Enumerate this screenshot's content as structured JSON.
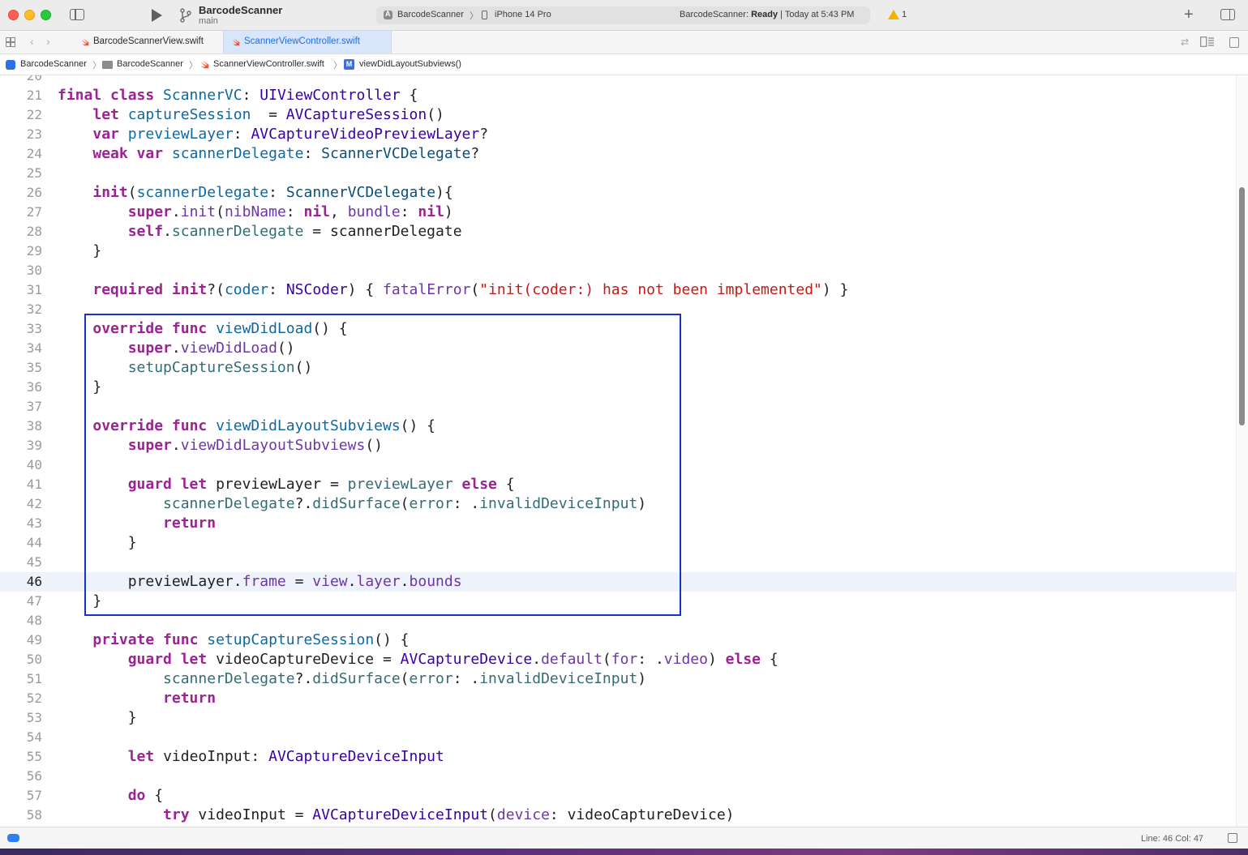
{
  "window": {
    "project_name": "BarcodeScanner",
    "branch": "main",
    "scheme": "BarcodeScanner",
    "device": "iPhone 14 Pro",
    "status_prefix": "BarcodeScanner: ",
    "status_state": "Ready",
    "status_time": " | Today at 5:43 PM",
    "warning_count": "1"
  },
  "tabs": [
    {
      "label": "BarcodeScannerView.swift",
      "active": false
    },
    {
      "label": "ScannerViewController.swift",
      "active": true
    }
  ],
  "breadcrumb": [
    "BarcodeScanner",
    "BarcodeScanner",
    "ScannerViewController.swift",
    "viewDidLayoutSubviews()"
  ],
  "editor": {
    "current_line": 46,
    "lines": [
      {
        "n": "20",
        "t": [
          [
            "pl",
            ""
          ]
        ]
      },
      {
        "n": "21",
        "t": [
          [
            "kw",
            "final class "
          ],
          [
            "decl",
            "ScannerVC"
          ],
          [
            "pl",
            ": "
          ],
          [
            "tyd",
            "UIViewController"
          ],
          [
            "pl",
            " {"
          ]
        ]
      },
      {
        "n": "22",
        "t": [
          [
            "pl",
            "    "
          ],
          [
            "kw",
            "let "
          ],
          [
            "decl",
            "captureSession"
          ],
          [
            "pl",
            "  = "
          ],
          [
            "tyd",
            "AVCaptureSession"
          ],
          [
            "pl",
            "()"
          ]
        ]
      },
      {
        "n": "23",
        "t": [
          [
            "pl",
            "    "
          ],
          [
            "kw",
            "var "
          ],
          [
            "decl",
            "previewLayer"
          ],
          [
            "pl",
            ": "
          ],
          [
            "tyd",
            "AVCaptureVideoPreviewLayer"
          ],
          [
            "pl",
            "?"
          ]
        ]
      },
      {
        "n": "24",
        "t": [
          [
            "pl",
            "    "
          ],
          [
            "kw",
            "weak var "
          ],
          [
            "decl",
            "scannerDelegate"
          ],
          [
            "pl",
            ": "
          ],
          [
            "ty",
            "ScannerVCDelegate"
          ],
          [
            "pl",
            "?"
          ]
        ]
      },
      {
        "n": "25",
        "t": [
          [
            "pl",
            ""
          ]
        ]
      },
      {
        "n": "26",
        "t": [
          [
            "pl",
            "    "
          ],
          [
            "kw",
            "init"
          ],
          [
            "pl",
            "("
          ],
          [
            "decl",
            "scannerDelegate"
          ],
          [
            "pl",
            ": "
          ],
          [
            "ty",
            "ScannerVCDelegate"
          ],
          [
            "pl",
            "){"
          ]
        ]
      },
      {
        "n": "27",
        "t": [
          [
            "pl",
            "        "
          ],
          [
            "kw",
            "super"
          ],
          [
            "pl",
            "."
          ],
          [
            "fn",
            "init"
          ],
          [
            "pl",
            "("
          ],
          [
            "fn",
            "nibName"
          ],
          [
            "pl",
            ": "
          ],
          [
            "kw",
            "nil"
          ],
          [
            "pl",
            ", "
          ],
          [
            "fn",
            "bundle"
          ],
          [
            "pl",
            ": "
          ],
          [
            "kw",
            "nil"
          ],
          [
            "pl",
            ")"
          ]
        ]
      },
      {
        "n": "28",
        "t": [
          [
            "pl",
            "        "
          ],
          [
            "kw",
            "self"
          ],
          [
            "pl",
            "."
          ],
          [
            "mem",
            "scannerDelegate"
          ],
          [
            "pl",
            " = scannerDelegate"
          ]
        ]
      },
      {
        "n": "29",
        "t": [
          [
            "pl",
            "    }"
          ]
        ]
      },
      {
        "n": "30",
        "t": [
          [
            "pl",
            ""
          ]
        ]
      },
      {
        "n": "31",
        "t": [
          [
            "pl",
            "    "
          ],
          [
            "kw",
            "required init"
          ],
          [
            "pl",
            "?("
          ],
          [
            "decl",
            "coder"
          ],
          [
            "pl",
            ": "
          ],
          [
            "tyd",
            "NSCoder"
          ],
          [
            "pl",
            ") { "
          ],
          [
            "fn",
            "fatalError"
          ],
          [
            "pl",
            "("
          ],
          [
            "str",
            "\"init(coder:) has not been implemented\""
          ],
          [
            "pl",
            ") }"
          ]
        ]
      },
      {
        "n": "32",
        "t": [
          [
            "pl",
            ""
          ]
        ]
      },
      {
        "n": "33",
        "t": [
          [
            "pl",
            "    "
          ],
          [
            "kw",
            "override func "
          ],
          [
            "decl",
            "viewDidLoad"
          ],
          [
            "pl",
            "() {"
          ]
        ]
      },
      {
        "n": "34",
        "t": [
          [
            "pl",
            "        "
          ],
          [
            "kw",
            "super"
          ],
          [
            "pl",
            "."
          ],
          [
            "fn",
            "viewDidLoad"
          ],
          [
            "pl",
            "()"
          ]
        ]
      },
      {
        "n": "35",
        "t": [
          [
            "pl",
            "        "
          ],
          [
            "mem",
            "setupCaptureSession"
          ],
          [
            "pl",
            "()"
          ]
        ]
      },
      {
        "n": "36",
        "t": [
          [
            "pl",
            "    }"
          ]
        ]
      },
      {
        "n": "37",
        "t": [
          [
            "pl",
            ""
          ]
        ]
      },
      {
        "n": "38",
        "t": [
          [
            "pl",
            "    "
          ],
          [
            "kw",
            "override func "
          ],
          [
            "decl",
            "viewDidLayoutSubviews"
          ],
          [
            "pl",
            "() {"
          ]
        ]
      },
      {
        "n": "39",
        "t": [
          [
            "pl",
            "        "
          ],
          [
            "kw",
            "super"
          ],
          [
            "pl",
            "."
          ],
          [
            "fn",
            "viewDidLayoutSubviews"
          ],
          [
            "pl",
            "()"
          ]
        ]
      },
      {
        "n": "40",
        "t": [
          [
            "pl",
            ""
          ]
        ]
      },
      {
        "n": "41",
        "t": [
          [
            "pl",
            "        "
          ],
          [
            "kw",
            "guard let "
          ],
          [
            "pl",
            "previewLayer = "
          ],
          [
            "mem",
            "previewLayer"
          ],
          [
            "pl",
            " "
          ],
          [
            "kw",
            "else"
          ],
          [
            "pl",
            " {"
          ]
        ]
      },
      {
        "n": "42",
        "t": [
          [
            "pl",
            "            "
          ],
          [
            "mem",
            "scannerDelegate"
          ],
          [
            "pl",
            "?."
          ],
          [
            "mem",
            "didSurface"
          ],
          [
            "pl",
            "("
          ],
          [
            "mem",
            "error"
          ],
          [
            "pl",
            ": ."
          ],
          [
            "mem",
            "invalidDeviceInput"
          ],
          [
            "pl",
            ")"
          ]
        ]
      },
      {
        "n": "43",
        "t": [
          [
            "pl",
            "            "
          ],
          [
            "kw",
            "return"
          ]
        ]
      },
      {
        "n": "44",
        "t": [
          [
            "pl",
            "        }"
          ]
        ]
      },
      {
        "n": "45",
        "t": [
          [
            "pl",
            ""
          ]
        ]
      },
      {
        "n": "46",
        "t": [
          [
            "pl",
            "        previewLayer."
          ],
          [
            "fn",
            "frame"
          ],
          [
            "pl",
            " = "
          ],
          [
            "fn",
            "view"
          ],
          [
            "pl",
            "."
          ],
          [
            "fn",
            "layer"
          ],
          [
            "pl",
            "."
          ],
          [
            "fn",
            "bounds"
          ]
        ]
      },
      {
        "n": "47",
        "t": [
          [
            "pl",
            "    }"
          ]
        ]
      },
      {
        "n": "48",
        "t": [
          [
            "pl",
            ""
          ]
        ]
      },
      {
        "n": "49",
        "t": [
          [
            "pl",
            "    "
          ],
          [
            "kw",
            "private func "
          ],
          [
            "decl",
            "setupCaptureSession"
          ],
          [
            "pl",
            "() {"
          ]
        ]
      },
      {
        "n": "50",
        "t": [
          [
            "pl",
            "        "
          ],
          [
            "kw",
            "guard let "
          ],
          [
            "pl",
            "videoCaptureDevice = "
          ],
          [
            "tyd",
            "AVCaptureDevice"
          ],
          [
            "pl",
            "."
          ],
          [
            "fn",
            "default"
          ],
          [
            "pl",
            "("
          ],
          [
            "fn",
            "for"
          ],
          [
            "pl",
            ": ."
          ],
          [
            "fn",
            "video"
          ],
          [
            "pl",
            ") "
          ],
          [
            "kw",
            "else"
          ],
          [
            "pl",
            " {"
          ]
        ]
      },
      {
        "n": "51",
        "t": [
          [
            "pl",
            "            "
          ],
          [
            "mem",
            "scannerDelegate"
          ],
          [
            "pl",
            "?."
          ],
          [
            "mem",
            "didSurface"
          ],
          [
            "pl",
            "("
          ],
          [
            "mem",
            "error"
          ],
          [
            "pl",
            ": ."
          ],
          [
            "mem",
            "invalidDeviceInput"
          ],
          [
            "pl",
            ")"
          ]
        ]
      },
      {
        "n": "52",
        "t": [
          [
            "pl",
            "            "
          ],
          [
            "kw",
            "return"
          ]
        ]
      },
      {
        "n": "53",
        "t": [
          [
            "pl",
            "        }"
          ]
        ]
      },
      {
        "n": "54",
        "t": [
          [
            "pl",
            ""
          ]
        ]
      },
      {
        "n": "55",
        "t": [
          [
            "pl",
            "        "
          ],
          [
            "kw",
            "let "
          ],
          [
            "pl",
            "videoInput: "
          ],
          [
            "tyd",
            "AVCaptureDeviceInput"
          ]
        ]
      },
      {
        "n": "56",
        "t": [
          [
            "pl",
            ""
          ]
        ]
      },
      {
        "n": "57",
        "t": [
          [
            "pl",
            "        "
          ],
          [
            "kw",
            "do"
          ],
          [
            "pl",
            " {"
          ]
        ]
      },
      {
        "n": "58",
        "t": [
          [
            "pl",
            "            "
          ],
          [
            "kw",
            "try "
          ],
          [
            "pl",
            "videoInput = "
          ],
          [
            "tyd",
            "AVCaptureDeviceInput"
          ],
          [
            "pl",
            "("
          ],
          [
            "fn",
            "device"
          ],
          [
            "pl",
            ": videoCaptureDevice)"
          ]
        ]
      }
    ]
  },
  "statusbar": {
    "cursor": "Line: 46  Col: 47"
  }
}
